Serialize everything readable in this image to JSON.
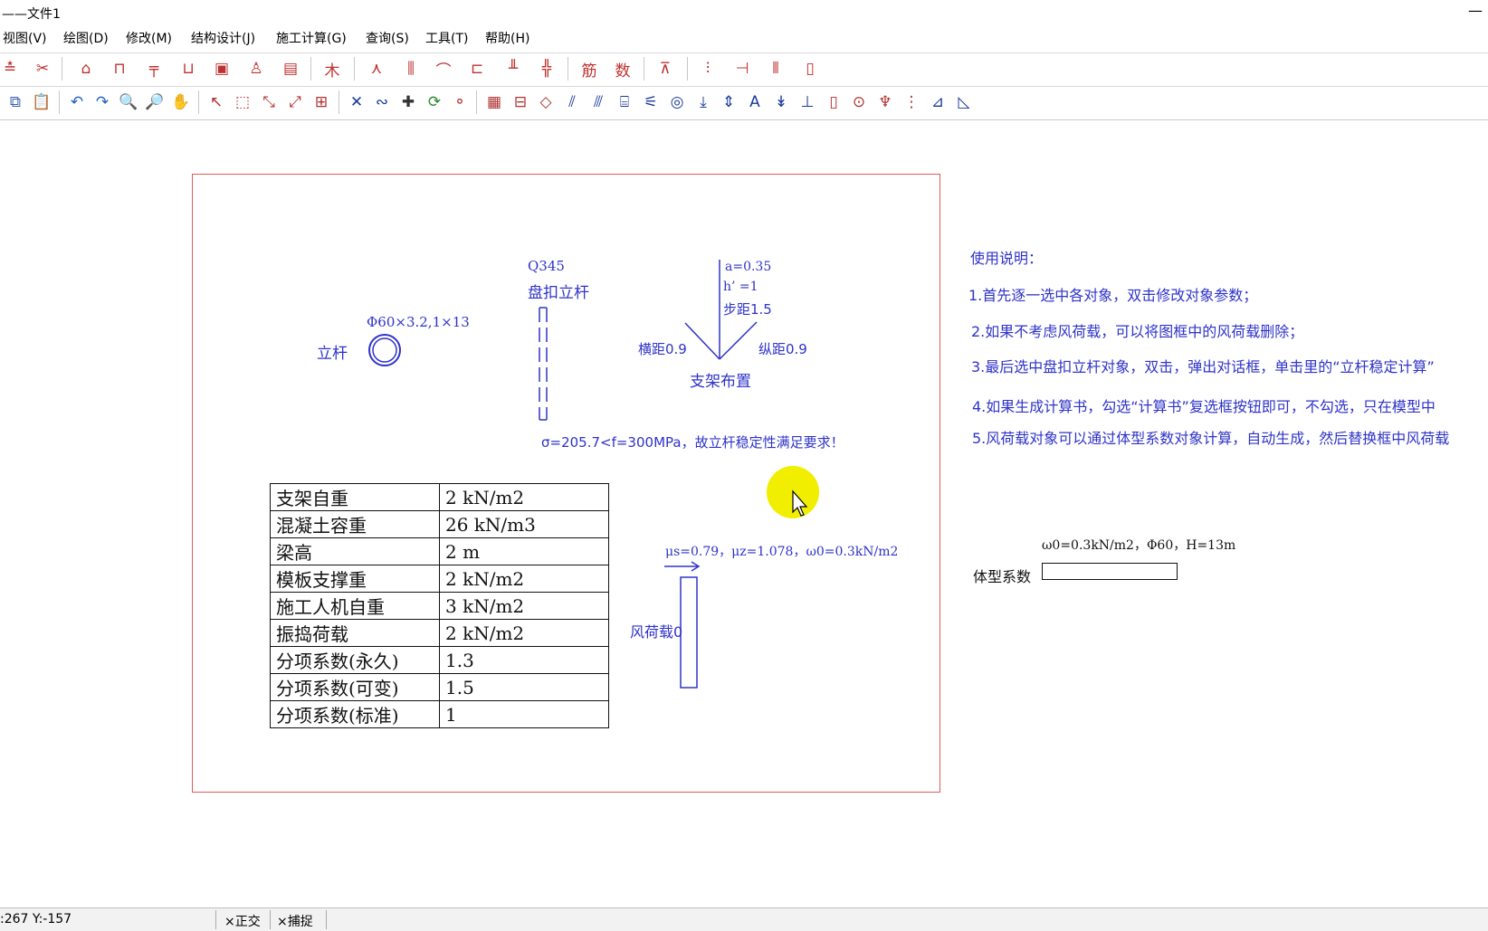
{
  "window": {
    "title": "——文件1",
    "minimize_glyph": "—"
  },
  "menu": [
    "视图(V)",
    "绘图(D)",
    "修改(M)",
    "结构设计(J)",
    "施工计算(G)",
    "查询(S)",
    "工具(T)",
    "帮助(H)"
  ],
  "toolbar1": [
    "steel-beam-icon",
    "cut-icon",
    "frame-a-icon",
    "frame-b-icon",
    "beam-tee-icon",
    "frame-c-icon",
    "box-icon",
    "lift-icon",
    "wall-icon",
    "wood-icon",
    "tripod-icon",
    "column-icon",
    "arch-icon",
    "support-icon",
    "post-icon",
    "scaffold-icon",
    "rebar-icon",
    "number-icon",
    "crane-icon",
    "pole-icon",
    "bracket-icon",
    "grid-icon",
    "bottle-icon"
  ],
  "toolbar1_glyphs": {
    "wood-icon": "木",
    "number-icon": "数",
    "rebar-icon": "筋"
  },
  "toolbar2": [
    "copy-icon",
    "paste-icon",
    "undo-icon",
    "redo-icon",
    "zoom-out-icon",
    "zoom-in-icon",
    "pan-hand-icon",
    "select-arrow-icon",
    "select-window-icon",
    "scale-icon",
    "scale-cross-icon",
    "block-icon",
    "delete-icon",
    "link-icon",
    "add-icon",
    "refresh-icon",
    "node-icon",
    "table-grid-icon",
    "table-icon",
    "diamond-icon",
    "hatch-icon",
    "hatch2-icon",
    "stair-icon",
    "wind-icon",
    "circle-target-icon",
    "arrow-down-icon",
    "double-arrow-icon",
    "text-a-icon",
    "arrow-down2-icon",
    "comb-icon",
    "tube-icon",
    "dot-circle-icon",
    "symbol-icon",
    "ruler-icon",
    "angle-icon",
    "triangle-icon"
  ],
  "drawing": {
    "pole_label": "立杆",
    "pole_spec": "Φ60×3.2,1×13",
    "steel_grade": "Q345",
    "panbuckle_label": "盘扣立杆",
    "a_value": "a=0.35",
    "h_value": "h’ =1",
    "step_value": "步距1.5",
    "horiz_spacing": "横距0.9",
    "long_spacing": "纵距0.9",
    "layout_label": "支架布置",
    "stability_result": "σ=205.7<f=300MPa，故立杆稳定性满足要求！",
    "wind_params": "μs=0.79，μz=1.078，ω0=0.3kN/m2",
    "wind_label": "风荷载0"
  },
  "params_table": [
    [
      "支架自重",
      "2  kN/m2"
    ],
    [
      "混凝土容重",
      "26  kN/m3"
    ],
    [
      "梁高",
      "2  m"
    ],
    [
      "模板支撑重",
      "2  kN/m2"
    ],
    [
      "施工人机自重",
      "3  kN/m2"
    ],
    [
      "振捣荷载",
      "2  kN/m2"
    ],
    [
      "分项系数(永久)",
      "1.3"
    ],
    [
      "分项系数(可变)",
      "1.5"
    ],
    [
      "分项系数(标准)",
      "1"
    ]
  ],
  "instructions": {
    "title": "使用说明：",
    "items": [
      "1.首先逐一选中各对象，双击修改对象参数；",
      "2.如果不考虑风荷载，可以将图框中的风荷载删除；",
      "3.最后选中盘扣立杆对象，双击，弹出对话框，单击里的“立杆稳定计算”",
      "4.如果生成计算书，勾选“计算书”复选框按钮即可，不勾选，只在模型中",
      "5.风荷载对象可以通过体型系数对象计算，自动生成，然后替换框中风荷载"
    ]
  },
  "shape_coef": {
    "params": "ω0=0.3kN/m2，Φ60，H=13m",
    "label": "体型系数",
    "value": ""
  },
  "status": {
    "coords": ":267  Y:-157",
    "ortho": "×正交",
    "snap": "×捕捉"
  },
  "colors": {
    "accent_blue": "#2f33c8",
    "frame_red": "#e05a5a",
    "icon_red": "#d02020",
    "cursor_highlight": "#f2ee00"
  }
}
